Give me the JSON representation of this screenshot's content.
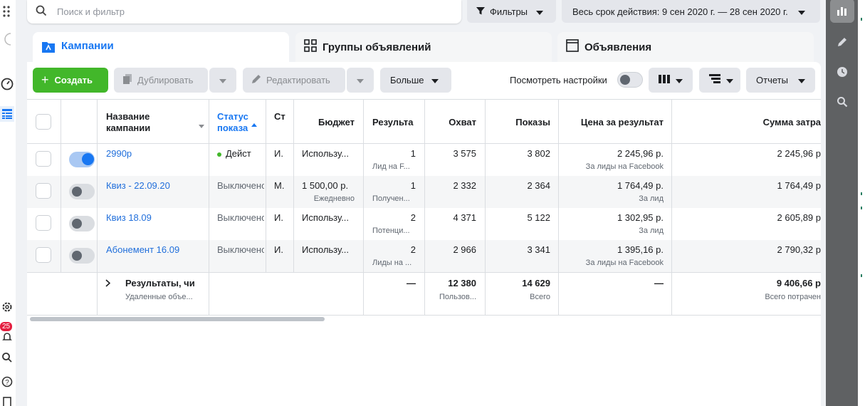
{
  "search": {
    "placeholder": "Поиск и фильтр"
  },
  "filters_label": "Фильтры",
  "date_range": "Весь срок действия: 9 сен 2020 г. — 28 сен 2020 г.",
  "tabs": [
    {
      "label": "Кампании"
    },
    {
      "label": "Группы объявлений"
    },
    {
      "label": "Объявления"
    }
  ],
  "toolbar": {
    "create": "Создать",
    "duplicate": "Дублировать",
    "edit": "Редактировать",
    "more": "Больше",
    "view_settings": "Посмотреть настройки",
    "reports": "Отчеты"
  },
  "left_badge": "25",
  "columns": {
    "name": "Название кампании",
    "name_l1": "Название",
    "name_l2": "кампании",
    "status_l1": "Статус",
    "status_l2": "показа",
    "strategy": "Ст",
    "budget": "Бюджет",
    "results": "Результа",
    "reach": "Охват",
    "impressions": "Показы",
    "cost_per_result": "Цена за результат",
    "amount_spent": "Сумма затра"
  },
  "rows": [
    {
      "name": "2990р",
      "status": "Дейст",
      "strategy": "И.",
      "budget": "Использу...",
      "budget_sub": "",
      "results": "1",
      "results_sub": "Лид на F...",
      "reach": "3 575",
      "impressions": "3 802",
      "cpr": "2 245,96 р.",
      "cpr_sub": "За лиды на Facebook",
      "spent": "2 245,96 р",
      "on": true
    },
    {
      "name": "Квиз - 22.09.20",
      "status": "Выключено",
      "strategy": "М.",
      "budget": "1 500,00 р.",
      "budget_sub": "Ежедневно",
      "results": "1",
      "results_sub": "Получен...",
      "reach": "2 332",
      "impressions": "2 364",
      "cpr": "1 764,49 р.",
      "cpr_sub": "За лид",
      "spent": "1 764,49 р",
      "on": false
    },
    {
      "name": "Квиз 18.09",
      "status": "Выключено",
      "strategy": "И.",
      "budget": "Использу...",
      "budget_sub": "",
      "results": "2",
      "results_sub": "Потенци...",
      "reach": "4 371",
      "impressions": "5 122",
      "cpr": "1 302,95 р.",
      "cpr_sub": "За лид",
      "spent": "2 605,89 р",
      "on": false
    },
    {
      "name": "Абонемент 16.09",
      "status": "Выключено",
      "strategy": "И.",
      "budget": "Использу...",
      "budget_sub": "",
      "results": "2",
      "results_sub": "Лиды на ...",
      "reach": "2 966",
      "impressions": "3 341",
      "cpr": "1 395,16 р.",
      "cpr_sub": "За лиды на Facebook",
      "spent": "2 790,32 р",
      "on": false
    }
  ],
  "totals": {
    "label": "Результаты, чи",
    "label_sub": "Удаленные объе...",
    "results": "—",
    "reach": "12 380",
    "reach_sub": "Пользов...",
    "impressions": "14 629",
    "impressions_sub": "Всего",
    "cpr": "—",
    "spent": "9 406,66 р",
    "spent_sub": "Всего потрачен"
  },
  "colors": {
    "accent": "#1877f2",
    "create": "#42b72a",
    "link": "#216fdb"
  }
}
